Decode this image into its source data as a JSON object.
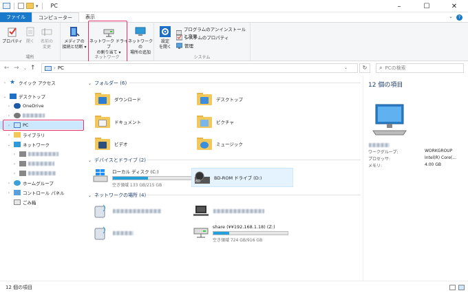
{
  "window": {
    "title": "PC"
  },
  "ribbon_tabs": [
    {
      "label": "ファイル"
    },
    {
      "label": "コンピューター"
    },
    {
      "label": "表示"
    }
  ],
  "ribbon": {
    "groups": {
      "location": "場所",
      "network": "ネットワーク",
      "system": "システム"
    },
    "buttons": {
      "properties": "プロパティ",
      "open": "開く",
      "rename_1": "名前の",
      "rename_2": "変更",
      "media_1": "メディアの",
      "media_2": "接続と切断 ▾",
      "map_drive_1": "ネットワーク ドライブ",
      "map_drive_2": "の割り当て ▾",
      "add_location_1": "ネットワークの",
      "add_location_2": "場所の追加",
      "settings_1": "設定",
      "settings_2": "を開く",
      "uninstall": "プログラムのアンインストールと変更",
      "system_props": "システムのプロパティ",
      "manage": "管理"
    }
  },
  "address": {
    "path": "PC",
    "search_placeholder": "PCの検索"
  },
  "nav": {
    "quick_access": "クイック アクセス",
    "desktop": "デスクトップ",
    "onedrive": "OneDrive",
    "pc": "PC",
    "library": "ライブラリ",
    "network": "ネットワーク",
    "homegroup": "ホームグループ",
    "control_panel": "コントロール パネル",
    "recycle": "ごみ箱"
  },
  "content": {
    "folders_header": "フォルダー (6)",
    "folders": [
      {
        "label": "ダウンロード"
      },
      {
        "label": "デスクトップ"
      },
      {
        "label": "ドキュメント"
      },
      {
        "label": "ピクチャ"
      },
      {
        "label": "ビデオ"
      },
      {
        "label": "ミュージック"
      }
    ],
    "devices_header": "デバイスとドライブ (2)",
    "drives": [
      {
        "label": "ローカル ディスク (C:)",
        "sub": "空き領域 133 GB/215 GB",
        "fill": 0.38
      },
      {
        "label": "BD-ROM ドライブ (D:)"
      }
    ],
    "network_header": "ネットワークの場所 (4)",
    "share": {
      "label": "share (¥¥192.168.1.18) (Z:)",
      "sub": "空き領域 724 GB/916 GB",
      "fill": 0.21
    }
  },
  "details": {
    "title": "12 個の項目",
    "workgroup_k": "ワークグループ:",
    "workgroup_v": "WORKGROUP",
    "cpu_k": "プロセッサ:",
    "cpu_v": "Intel(R) Core(...",
    "mem_k": "メモリ:",
    "mem_v": "4.00 GB"
  },
  "status": {
    "count": "12 個の項目"
  }
}
